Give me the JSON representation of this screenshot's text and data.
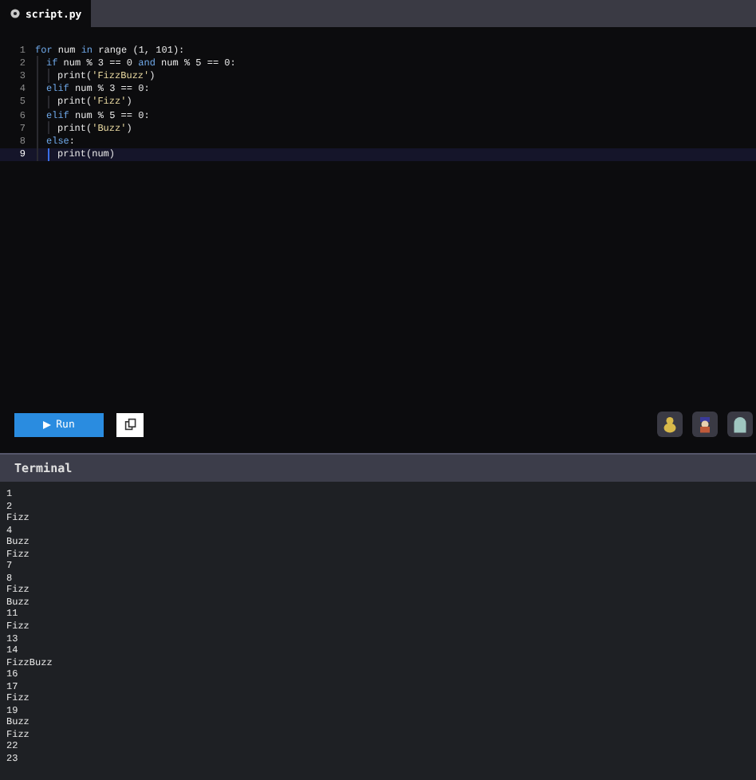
{
  "tabs": [
    {
      "label": "script.py",
      "selected": true
    }
  ],
  "code": [
    {
      "number": "1",
      "selected": false,
      "tokens": [
        {
          "text": "for",
          "kind": "keyword"
        },
        {
          "text": " num ",
          "kind": "plain"
        },
        {
          "text": "in",
          "kind": "keyword"
        },
        {
          "text": " range (1, 101):",
          "kind": "plain"
        }
      ],
      "children": [
        {
          "number": "2",
          "selected": false,
          "tokens": [
            {
              "text": "if",
              "kind": "keyword"
            },
            {
              "text": " num % 3 == 0 ",
              "kind": "plain"
            },
            {
              "text": "and",
              "kind": "keyword"
            },
            {
              "text": " num % 5 == 0:",
              "kind": "plain"
            }
          ],
          "children": [
            {
              "number": "3",
              "selected": false,
              "tokens": [
                {
                  "text": "print(",
                  "kind": "plain"
                },
                {
                  "text": "'FizzBuzz'",
                  "kind": "string"
                },
                {
                  "text": ")",
                  "kind": "plain"
                }
              ]
            }
          ]
        },
        {
          "number": "4",
          "selected": false,
          "tokens": [
            {
              "text": "elif",
              "kind": "keyword"
            },
            {
              "text": " num % 3 == 0:",
              "kind": "plain"
            }
          ],
          "children": [
            {
              "number": "5",
              "selected": false,
              "tokens": [
                {
                  "text": "print(",
                  "kind": "plain"
                },
                {
                  "text": "'Fizz'",
                  "kind": "string"
                },
                {
                  "text": ")",
                  "kind": "plain"
                }
              ]
            }
          ]
        },
        {
          "number": "6",
          "selected": false,
          "tokens": [
            {
              "text": "elif",
              "kind": "keyword"
            },
            {
              "text": " num % 5 == 0:",
              "kind": "plain"
            }
          ],
          "children": [
            {
              "number": "7",
              "selected": false,
              "tokens": [
                {
                  "text": "print(",
                  "kind": "plain"
                },
                {
                  "text": "'Buzz'",
                  "kind": "string"
                },
                {
                  "text": ")",
                  "kind": "plain"
                }
              ]
            }
          ]
        },
        {
          "number": "8",
          "selected": false,
          "tokens": [
            {
              "text": "else",
              "kind": "keyword"
            },
            {
              "text": ":",
              "kind": "plain"
            }
          ],
          "children": [
            {
              "number": "9",
              "selected": true,
              "tokens": [
                {
                  "text": "print(num)",
                  "kind": "plain"
                }
              ]
            }
          ]
        }
      ]
    }
  ],
  "run_button": {
    "label": "Run"
  },
  "terminal": {
    "title": "Terminal",
    "lines": [
      "1",
      "2",
      "Fizz",
      "4",
      "Buzz",
      "Fizz",
      "7",
      "8",
      "Fizz",
      "Buzz",
      "11",
      "Fizz",
      "13",
      "14",
      "FizzBuzz",
      "16",
      "17",
      "Fizz",
      "19",
      "Buzz",
      "Fizz",
      "22",
      "23"
    ]
  }
}
